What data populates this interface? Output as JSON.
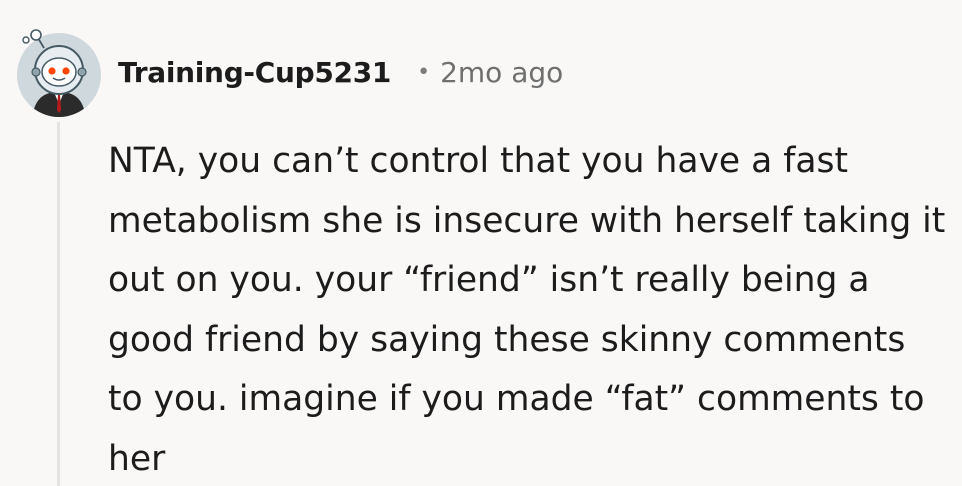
{
  "comment": {
    "author": "Training-Cup5231",
    "separator": "•",
    "timestamp": "2mo ago",
    "body": "NTA, you can’t control that you have a fast metabolism she is insecure with herself taking it out on you. your “friend” isn’t really being a good friend by saying these skinny comments to you. imagine if you made “fat” comments to her"
  },
  "colors": {
    "background": "#faf8f7",
    "text": "#1c1c1c",
    "muted": "#6f6f6f",
    "thread_line": "#e6e2e0",
    "avatar_bg": "#cfd8dc",
    "snoo_eyes": "#ff4500"
  },
  "icons": {
    "avatar": "snoo-astronaut-avatar-icon"
  }
}
